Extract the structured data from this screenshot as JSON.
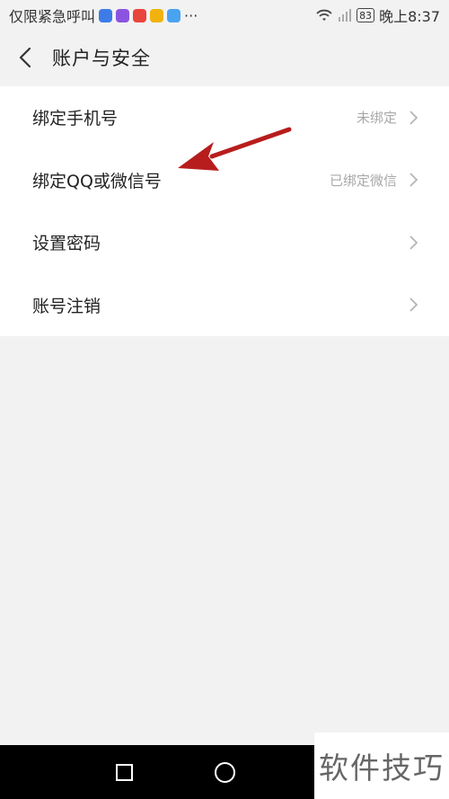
{
  "status_bar": {
    "carrier_text": "仅限紧急呼叫",
    "more_indicator": "···",
    "battery_level": "83",
    "time": "晚上8:37",
    "notification_icons": [
      "messenger-app-icon",
      "chat-app-icon",
      "video-app-icon",
      "game-app-icon",
      "store-app-icon"
    ],
    "signal_icons": [
      "wifi-icon",
      "no-sim-signal-icon"
    ]
  },
  "header": {
    "title": "账户与安全",
    "back_icon": "chevron-left-icon"
  },
  "settings": {
    "items": [
      {
        "label": "绑定手机号",
        "value": "未绑定"
      },
      {
        "label": "绑定QQ或微信号",
        "value": "已绑定微信"
      },
      {
        "label": "设置密码",
        "value": ""
      },
      {
        "label": "账号注销",
        "value": ""
      }
    ]
  },
  "annotation": {
    "type": "red-arrow",
    "color": "#b81d1d",
    "points_to": "绑定QQ或微信号"
  },
  "nav_bar": {
    "buttons": [
      "recent-apps-icon",
      "home-icon"
    ]
  },
  "watermark": {
    "text": "软件技巧"
  },
  "colors": {
    "background": "#f2f2f2",
    "card": "#ffffff",
    "secondary_text": "#a8a8a8"
  }
}
